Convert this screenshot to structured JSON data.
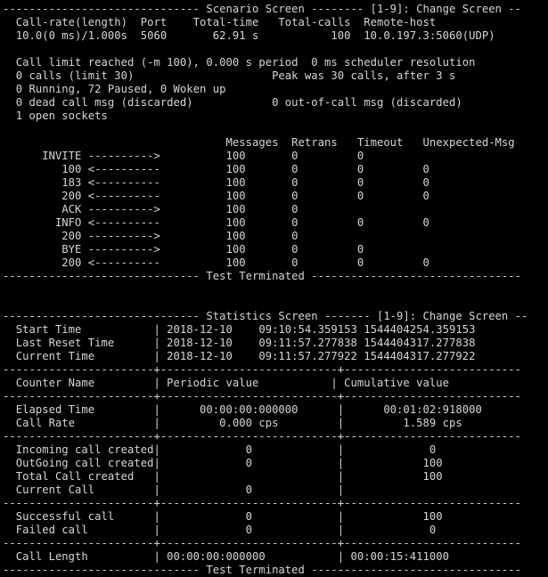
{
  "terminal": {
    "app": "sipp",
    "colors": {
      "background": "#000000",
      "foreground": "#d6d6d6"
    },
    "columns": 80,
    "rows": 43
  },
  "scenario_screen": {
    "banner": "------------------------------ Scenario Screen -------- [1-9]: Change Screen --",
    "summary_headers": {
      "call_rate": "Call-rate(length)",
      "port": "Port",
      "total_time": "Total-time",
      "total_calls": "Total-calls",
      "remote_host": "Remote-host"
    },
    "summary_values": {
      "call_rate": "10.0(0 ms)/1.000s",
      "port": "5060",
      "total_time": "62.91 s",
      "total_calls": "100",
      "remote_host": "10.0.197.3:5060(UDP)"
    },
    "status_lines": [
      "  Call limit reached (-m 100), 0.000 s period  0 ms scheduler resolution",
      "  0 calls (limit 30)                     Peak was 30 calls, after 3 s",
      "  0 Running, 72 Paused, 0 Woken up",
      "  0 dead call msg (discarded)            0 out-of-call msg (discarded)",
      "  1 open sockets"
    ],
    "status_details": {
      "call_limit_reached": "Call limit reached (-m 100), 0.000 s period",
      "scheduler_resolution": "0 ms scheduler resolution",
      "calls_limit": "0 calls (limit 30)",
      "peak": "Peak was 30 calls, after 3 s",
      "running_paused_woken": "0 Running, 72 Paused, 0 Woken up",
      "dead_call_msg": "0 dead call msg (discarded)",
      "out_of_call_msg": "0 out-of-call msg (discarded)",
      "open_sockets": "1 open sockets"
    },
    "message_table": {
      "headers": [
        "Messages",
        "Retrans",
        "Timeout",
        "Unexpected-Msg"
      ],
      "rows": [
        {
          "label": "INVITE",
          "arrow": "---------->",
          "messages": "100",
          "retrans": "0",
          "timeout": "0",
          "unexpected": ""
        },
        {
          "label": "100",
          "arrow": "<----------",
          "messages": "100",
          "retrans": "0",
          "timeout": "0",
          "unexpected": "0"
        },
        {
          "label": "183",
          "arrow": "<----------",
          "messages": "100",
          "retrans": "0",
          "timeout": "0",
          "unexpected": "0"
        },
        {
          "label": "200",
          "arrow": "<----------",
          "messages": "100",
          "retrans": "0",
          "timeout": "0",
          "unexpected": "0"
        },
        {
          "label": "ACK",
          "arrow": "---------->",
          "messages": "100",
          "retrans": "0",
          "timeout": "",
          "unexpected": ""
        },
        {
          "label": "INFO",
          "arrow": "<----------",
          "messages": "100",
          "retrans": "0",
          "timeout": "0",
          "unexpected": "0"
        },
        {
          "label": "200",
          "arrow": "---------->",
          "messages": "100",
          "retrans": "0",
          "timeout": "",
          "unexpected": ""
        },
        {
          "label": "BYE",
          "arrow": "---------->",
          "messages": "100",
          "retrans": "0",
          "timeout": "0",
          "unexpected": ""
        },
        {
          "label": "200",
          "arrow": "<----------",
          "messages": "100",
          "retrans": "0",
          "timeout": "0",
          "unexpected": "0"
        }
      ]
    },
    "footer": "------------------------------ Test Terminated --------------------------------"
  },
  "statistics_screen": {
    "banner": "------------------------------ Statistics Screen ------- [1-9]: Change Screen --",
    "time_rows": [
      {
        "label": "Start Time",
        "date": "2018-12-10",
        "time": "09:10:54.359153",
        "epoch": "1544404254.359153"
      },
      {
        "label": "Last Reset Time",
        "date": "2018-12-10",
        "time": "09:11:57.277838",
        "epoch": "1544404317.277838"
      },
      {
        "label": "Current Time",
        "date": "2018-12-10",
        "time": "09:11:57.277922",
        "epoch": "1544404317.277922"
      }
    ],
    "column_headers": {
      "counter_name": "Counter Name",
      "periodic_value": "Periodic value",
      "cumulative_value": "Cumulative value"
    },
    "groups": [
      {
        "rows": [
          {
            "name": "Elapsed Time",
            "periodic": "00:00:00:000000",
            "cumulative": "00:01:02:918000",
            "align": "center"
          },
          {
            "name": "Call Rate",
            "periodic": "0.000 cps",
            "cumulative": "1.589 cps",
            "align": "center"
          }
        ]
      },
      {
        "rows": [
          {
            "name": "Incoming call created",
            "periodic": "0",
            "cumulative": "0",
            "align": "center"
          },
          {
            "name": "OutGoing call created",
            "periodic": "0",
            "cumulative": "100",
            "align": "center"
          },
          {
            "name": "Total Call created",
            "periodic": "",
            "cumulative": "100",
            "align": "center"
          },
          {
            "name": "Current Call",
            "periodic": "0",
            "cumulative": "",
            "align": "center"
          }
        ]
      },
      {
        "rows": [
          {
            "name": "Successful call",
            "periodic": "0",
            "cumulative": "100",
            "align": "center"
          },
          {
            "name": "Failed call",
            "periodic": "0",
            "cumulative": "0",
            "align": "center"
          }
        ]
      },
      {
        "rows": [
          {
            "name": "Call Length",
            "periodic": "00:00:00:000000",
            "cumulative": "00:00:15:411000",
            "align": "left"
          }
        ]
      }
    ],
    "separator_line": "-----------------------+---------------------------+---------------------------",
    "footer": "------------------------------ Test Terminated --------------------------------"
  }
}
